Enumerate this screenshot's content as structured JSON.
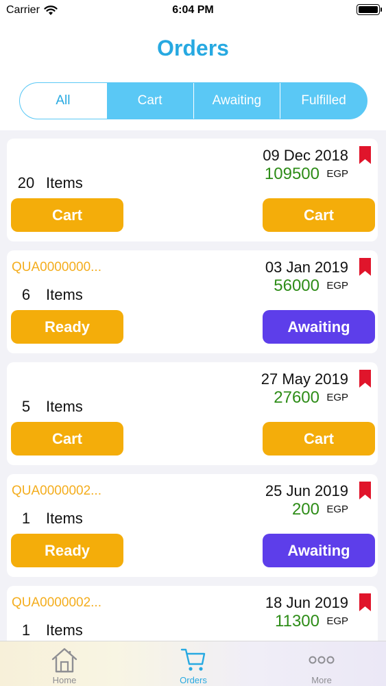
{
  "status_bar": {
    "carrier": "Carrier",
    "time": "6:04 PM"
  },
  "header": {
    "title": "Orders"
  },
  "filter_tabs": [
    {
      "label": "All",
      "active": true
    },
    {
      "label": "Cart",
      "active": false
    },
    {
      "label": "Awaiting",
      "active": false
    },
    {
      "label": "Fulfilled",
      "active": false
    }
  ],
  "orders": [
    {
      "reference": "",
      "date": "09 Dec 2018",
      "price": "109500",
      "currency": "EGP",
      "item_count": "20",
      "items_label": "Items",
      "left_button": "Cart",
      "right_button": "Cart"
    },
    {
      "reference": "QUA0000000...",
      "date": "03 Jan 2019",
      "price": "56000",
      "currency": "EGP",
      "item_count": "6",
      "items_label": "Items",
      "left_button": "Ready",
      "right_button": "Awaiting"
    },
    {
      "reference": "",
      "date": "27 May 2019",
      "price": "27600",
      "currency": "EGP",
      "item_count": "5",
      "items_label": "Items",
      "left_button": "Cart",
      "right_button": "Cart"
    },
    {
      "reference": "QUA0000002...",
      "date": "25 Jun 2019",
      "price": "200",
      "currency": "EGP",
      "item_count": "1",
      "items_label": "Items",
      "left_button": "Ready",
      "right_button": "Awaiting"
    },
    {
      "reference": "QUA0000002...",
      "date": "18 Jun 2019",
      "price": "11300",
      "currency": "EGP",
      "item_count": "1",
      "items_label": "Items",
      "left_button": "",
      "right_button": ""
    }
  ],
  "tab_bar": {
    "tabs": [
      {
        "label": "Home",
        "icon": "home-icon",
        "active": false
      },
      {
        "label": "Orders",
        "icon": "cart-icon",
        "active": true
      },
      {
        "label": "More",
        "icon": "more-icon",
        "active": false
      }
    ]
  },
  "colors": {
    "accent": "#27a9e1",
    "segment": "#5ac8f5",
    "cart_button": "#f4ad0a",
    "awaiting_button": "#5d3eea",
    "price": "#2d8c17",
    "reference": "#f4ad1d",
    "bookmark": "#e0152b"
  }
}
